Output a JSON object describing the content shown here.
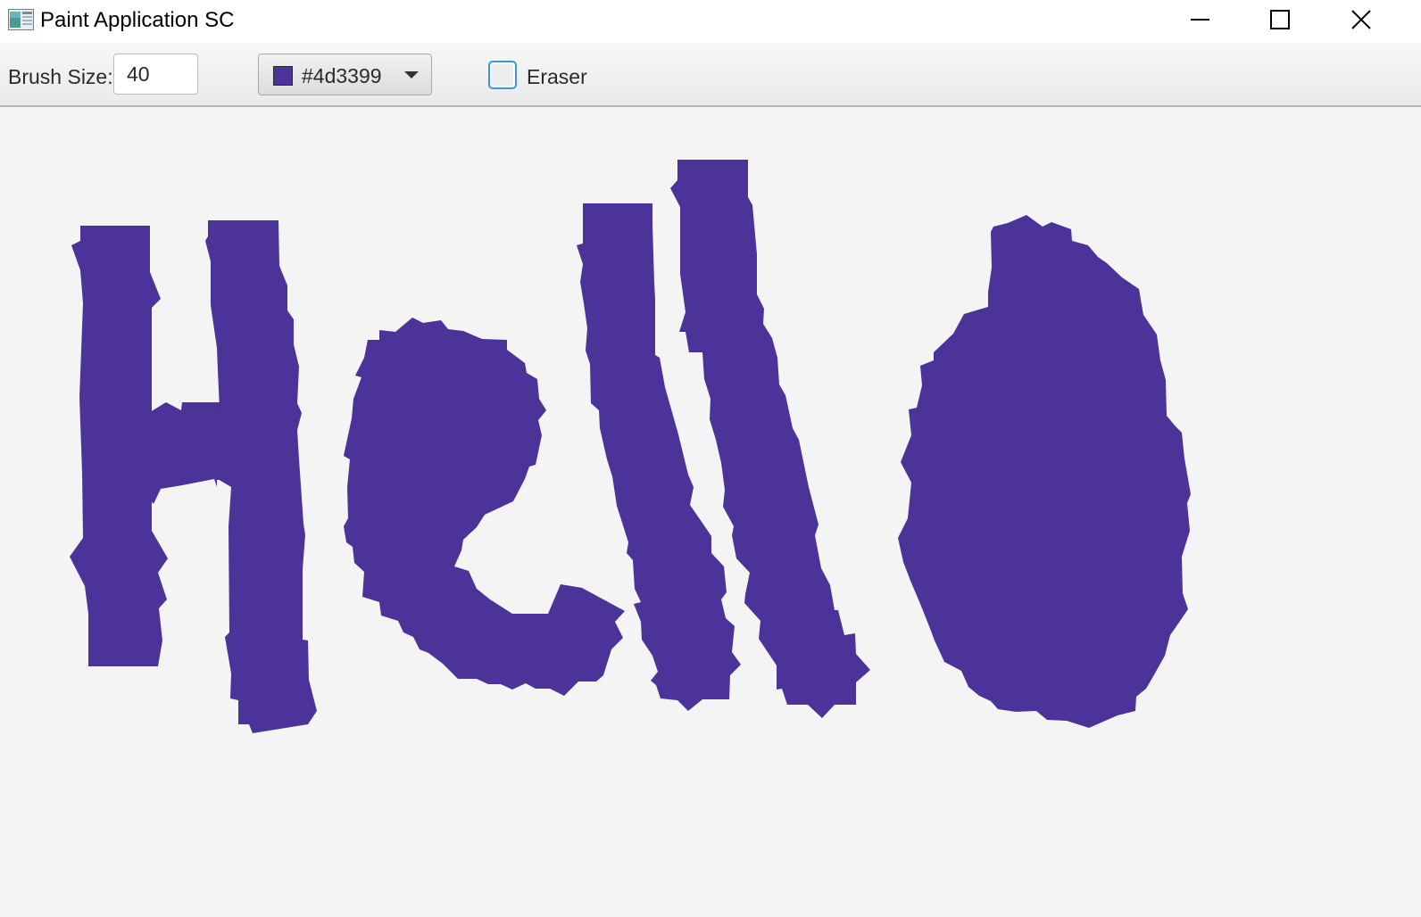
{
  "window": {
    "title": "Paint Application SC",
    "icon": "paint-app-icon"
  },
  "titlebar_buttons": {
    "minimize_icon": "minimize-icon",
    "maximize_icon": "maximize-icon",
    "close_icon": "close-icon"
  },
  "toolbar": {
    "brush_size_label": "Brush Size:",
    "brush_size_value": "40",
    "color_value": "#4d3399",
    "color_picker_icon": "chevron-down-icon",
    "eraser_label": "Eraser",
    "eraser_checked": false
  },
  "canvas": {
    "background": "#f4f4f4",
    "stroke_color": "#4d3399",
    "brush_size": 40
  },
  "colors": {
    "accent": "#3a98d8",
    "paint": "#4b3399"
  }
}
